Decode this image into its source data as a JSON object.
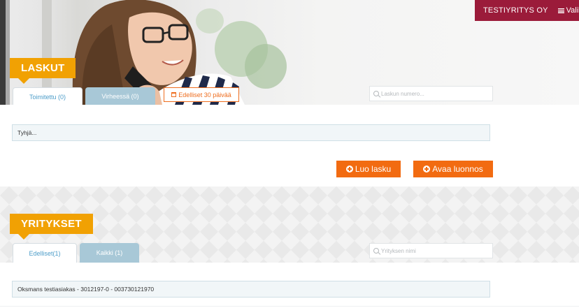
{
  "header": {
    "company": "TESTIYRITYS OY",
    "menu_label": "Valik"
  },
  "laskut": {
    "title": "LASKUT",
    "tabs": [
      {
        "label": "Toimitettu (0)",
        "active": true
      },
      {
        "label": "Virheessä (0)",
        "active": false
      },
      {
        "label": "Edelliset 30 päivää",
        "active": false
      }
    ],
    "search_placeholder": "Laskun numero...",
    "list_items": [
      "Tyhjä..."
    ],
    "buttons": {
      "create": "Luo lasku",
      "open_draft": "Avaa luonnos"
    }
  },
  "yritykset": {
    "title": "YRITYKSET",
    "tabs": [
      {
        "label": "Edelliset(1)",
        "active": true
      },
      {
        "label": "Kaikki (1)",
        "active": false
      }
    ],
    "search_placeholder": "Yrityksen nimi",
    "list_items": [
      "Oksmans testiasiakas - 3012197-0 - 003730121970"
    ]
  },
  "colors": {
    "brand": "#9b1b3a",
    "accent_orange": "#f1a103",
    "button_orange": "#f26b11",
    "tab_blue": "#a8c8d7"
  }
}
